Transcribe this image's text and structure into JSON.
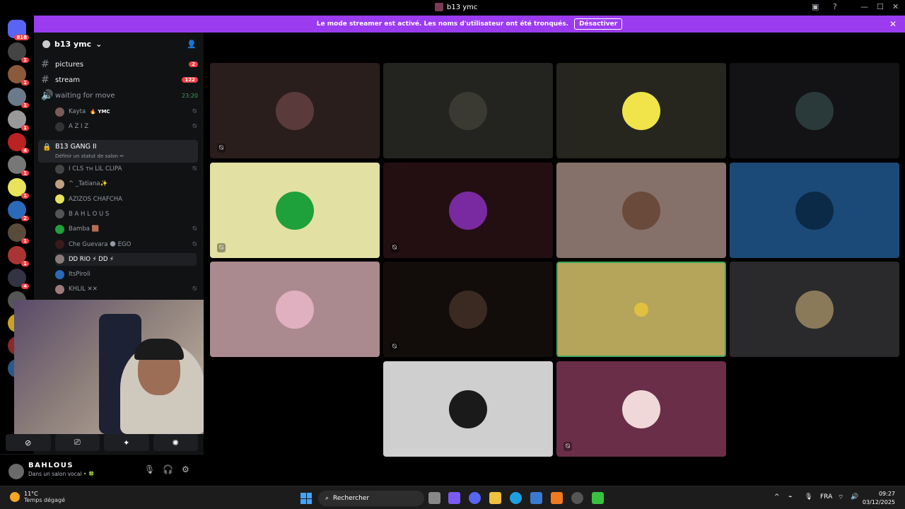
{
  "window": {
    "title": "b13 ymc",
    "controls": [
      "—",
      "☐",
      "✕"
    ]
  },
  "banner": {
    "message": "Le mode streamer est activé. Les noms d'utilisateur ont été tronqués.",
    "button_label": "Désactiver",
    "close": "✕"
  },
  "servers": [
    {
      "color": "#5865f2",
      "badge": "818"
    },
    {
      "color": "#444",
      "badge": "1"
    },
    {
      "color": "#8a5a3b",
      "badge": "1"
    },
    {
      "color": "#6a7a8a",
      "badge": "1"
    },
    {
      "color": "#999",
      "badge": "1"
    },
    {
      "color": "#b22",
      "badge": "4"
    },
    {
      "color": "#777",
      "badge": "1"
    },
    {
      "color": "#e8e35a",
      "badge": "1"
    },
    {
      "color": "#2a6ab8",
      "badge": "2"
    },
    {
      "color": "#5a4a3a",
      "badge": "1"
    },
    {
      "color": "#a33",
      "badge": "1"
    },
    {
      "color": "#334",
      "badge": "4"
    },
    {
      "color": "#555",
      "badge": ""
    },
    {
      "color": "#c9a227",
      "badge": ""
    },
    {
      "color": "#8a2a2a",
      "badge": ""
    },
    {
      "color": "#2a5a8a",
      "badge": ""
    }
  ],
  "server_header": {
    "name": "b13 ymc"
  },
  "channels": [
    {
      "name": "pictures",
      "badge": "2"
    },
    {
      "name": "stream",
      "badge": "122"
    }
  ],
  "voice_waiting": {
    "name": "waiting for move",
    "time": "23:20"
  },
  "waiting_users": [
    {
      "name": "Kayta",
      "tag": "🔥 YMC"
    },
    {
      "name": "A Z I Z",
      "tag": ""
    }
  ],
  "voice_active": {
    "name": "B13 GANG II",
    "status": "Définir un statut de salon ✏"
  },
  "active_users": [
    {
      "name": "I CLS ᴛʜ LIL CLIPA",
      "muted": true
    },
    {
      "name": "^ _Tatiana✨",
      "muted": false
    },
    {
      "name": "AZIZOS CHAFCHA",
      "muted": false
    },
    {
      "name": "B A H L O U S",
      "muted": false
    },
    {
      "name": "Bamba 🟫",
      "muted": true
    },
    {
      "name": "Che Guevara 🌑 EGO",
      "muted": true
    },
    {
      "name": "DD RIO ⚡ DD ⚡",
      "muted": false
    },
    {
      "name": "ItsPiroli",
      "muted": false
    },
    {
      "name": "KHLIL ✕✕",
      "muted": true
    }
  ],
  "user_panel": {
    "name": "BAHLOUS",
    "status": "Dans un salon vocal • 🍀"
  },
  "tiles": [
    {
      "bg": "#2a1e1d",
      "avatar": "#5a3a3a",
      "muted": true,
      "speaking": false
    },
    {
      "bg": "#23231f",
      "avatar": "#3a3a32",
      "muted": false,
      "speaking": false
    },
    {
      "bg": "#26261f",
      "avatar": "#f0e44a",
      "muted": false,
      "speaking": false
    },
    {
      "bg": "#131316",
      "avatar": "#2a3a3a",
      "muted": false,
      "speaking": false
    },
    {
      "bg": "#e2e0a3",
      "avatar": "#1ea03a",
      "muted": true,
      "speaking": false
    },
    {
      "bg": "#230f12",
      "avatar": "#7a2aa0",
      "muted": true,
      "speaking": false
    },
    {
      "bg": "#85716a",
      "avatar": "#6a4a3a",
      "muted": false,
      "speaking": false
    },
    {
      "bg": "#1b4a78",
      "avatar": "#0a2a48",
      "muted": false,
      "speaking": false
    },
    {
      "bg": "#ab8a8f",
      "avatar": "#e0b0c0",
      "muted": false,
      "speaking": false
    },
    {
      "bg": "#120c0a",
      "avatar": "#3a2a22",
      "muted": true,
      "speaking": false
    },
    {
      "bg": "#b5a55a",
      "avatar": "#b5a55a",
      "muted": false,
      "speaking": true
    },
    {
      "bg": "#2a2a2c",
      "avatar": "#8a7a5a",
      "muted": false,
      "speaking": false
    },
    {
      "bg": "#cfcfcf",
      "avatar": "#1a1a1a",
      "muted": false,
      "speaking": false
    },
    {
      "bg": "#6a2e48",
      "avatar": "#f0d8d8",
      "muted": true,
      "speaking": false
    }
  ],
  "taskbar": {
    "weather_temp": "11°C",
    "weather_desc": "Temps dégagé",
    "search_placeholder": "Rechercher",
    "lang": "FRA",
    "time": "09:27",
    "date": "03/12/2025"
  }
}
